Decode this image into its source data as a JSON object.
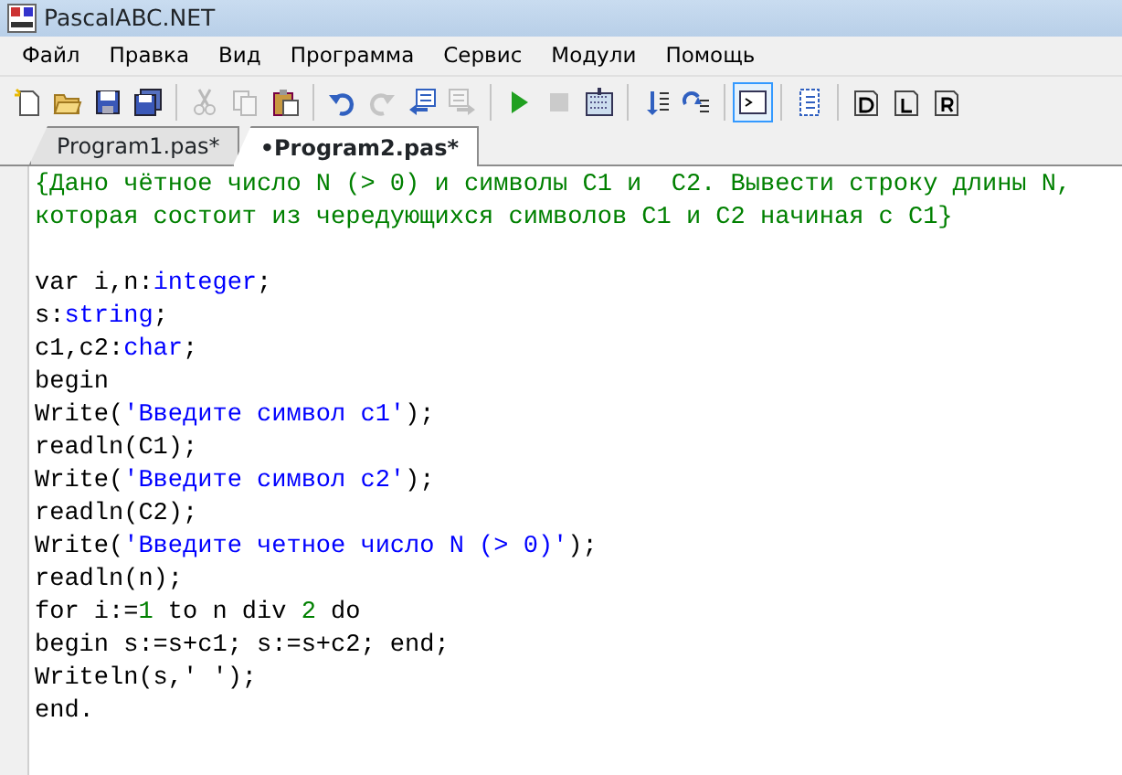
{
  "window": {
    "title": "PascalABC.NET"
  },
  "menu": [
    "Файл",
    "Правка",
    "Вид",
    "Программа",
    "Сервис",
    "Модули",
    "Помощь"
  ],
  "toolbar": [
    [
      {
        "kind": "new",
        "disabled": false,
        "pressed": false
      },
      {
        "kind": "open",
        "disabled": false,
        "pressed": false
      },
      {
        "kind": "save",
        "disabled": false,
        "pressed": false
      },
      {
        "kind": "saveall",
        "disabled": false,
        "pressed": false
      }
    ],
    [
      {
        "kind": "cut",
        "disabled": true,
        "pressed": false
      },
      {
        "kind": "copy",
        "disabled": true,
        "pressed": false
      },
      {
        "kind": "paste",
        "disabled": false,
        "pressed": false
      }
    ],
    [
      {
        "kind": "undo",
        "disabled": false,
        "pressed": false
      },
      {
        "kind": "redo",
        "disabled": true,
        "pressed": false
      },
      {
        "kind": "back",
        "disabled": false,
        "pressed": false
      },
      {
        "kind": "forward",
        "disabled": true,
        "pressed": false
      }
    ],
    [
      {
        "kind": "run",
        "disabled": false,
        "pressed": false
      },
      {
        "kind": "stop",
        "disabled": true,
        "pressed": false
      },
      {
        "kind": "compile",
        "disabled": false,
        "pressed": false
      }
    ],
    [
      {
        "kind": "stepin",
        "disabled": false,
        "pressed": false
      },
      {
        "kind": "stepover",
        "disabled": false,
        "pressed": false
      }
    ],
    [
      {
        "kind": "console",
        "disabled": false,
        "pressed": true
      }
    ],
    [
      {
        "kind": "outline",
        "disabled": false,
        "pressed": false
      }
    ],
    [
      {
        "kind": "docd",
        "disabled": false,
        "pressed": false
      },
      {
        "kind": "docl",
        "disabled": false,
        "pressed": false
      },
      {
        "kind": "docr",
        "disabled": false,
        "pressed": false
      }
    ]
  ],
  "tabs": [
    {
      "label": "Program1.pas*",
      "selected": false
    },
    {
      "label": "•Program2.pas*",
      "selected": true
    }
  ],
  "code": [
    {
      "kind": "code",
      "tokens": [
        {
          "kind": "comment",
          "text": "{Дано чётное число N (> 0) и символы C1 и  C2. Вывести строку длины N,"
        }
      ]
    },
    {
      "kind": "code",
      "tokens": [
        {
          "kind": "comment",
          "text": "которая состоит из чередующихся символов C1 и C2 начиная с C1}"
        }
      ]
    },
    {
      "kind": "blank"
    },
    {
      "kind": "code",
      "tokens": [
        {
          "kind": "plain",
          "text": "var i,n:"
        },
        {
          "kind": "type",
          "text": "integer"
        },
        {
          "kind": "plain",
          "text": ";"
        }
      ]
    },
    {
      "kind": "code",
      "tokens": [
        {
          "kind": "plain",
          "text": "s:"
        },
        {
          "kind": "type",
          "text": "string"
        },
        {
          "kind": "plain",
          "text": ";"
        }
      ]
    },
    {
      "kind": "code",
      "tokens": [
        {
          "kind": "plain",
          "text": "c1,c2:"
        },
        {
          "kind": "type",
          "text": "char"
        },
        {
          "kind": "plain",
          "text": ";"
        }
      ]
    },
    {
      "kind": "code",
      "tokens": [
        {
          "kind": "plain",
          "text": "begin"
        }
      ]
    },
    {
      "kind": "code",
      "tokens": [
        {
          "kind": "plain",
          "text": "Write("
        },
        {
          "kind": "string",
          "text": "'Введите символ c1'"
        },
        {
          "kind": "plain",
          "text": ");"
        }
      ]
    },
    {
      "kind": "code",
      "tokens": [
        {
          "kind": "plain",
          "text": "readln(C1);"
        }
      ]
    },
    {
      "kind": "code",
      "tokens": [
        {
          "kind": "plain",
          "text": "Write("
        },
        {
          "kind": "string",
          "text": "'Введите символ c2'"
        },
        {
          "kind": "plain",
          "text": ");"
        }
      ]
    },
    {
      "kind": "code",
      "tokens": [
        {
          "kind": "plain",
          "text": "readln(C2);"
        }
      ]
    },
    {
      "kind": "code",
      "tokens": [
        {
          "kind": "plain",
          "text": "Write("
        },
        {
          "kind": "string",
          "text": "'Введите четное число N (> 0)'"
        },
        {
          "kind": "plain",
          "text": ");"
        }
      ]
    },
    {
      "kind": "code",
      "tokens": [
        {
          "kind": "plain",
          "text": "readln(n);"
        }
      ]
    },
    {
      "kind": "code",
      "tokens": [
        {
          "kind": "plain",
          "text": "for i:="
        },
        {
          "kind": "number",
          "text": "1"
        },
        {
          "kind": "plain",
          "text": " to n div "
        },
        {
          "kind": "number",
          "text": "2"
        },
        {
          "kind": "plain",
          "text": " do"
        }
      ]
    },
    {
      "kind": "code",
      "tokens": [
        {
          "kind": "plain",
          "text": "begin s:=s+c1; s:=s+c2; end;"
        }
      ]
    },
    {
      "kind": "code",
      "tokens": [
        {
          "kind": "plain",
          "text": "Writeln(s,' ');"
        }
      ]
    },
    {
      "kind": "code",
      "tokens": [
        {
          "kind": "plain",
          "text": "end."
        }
      ]
    }
  ]
}
